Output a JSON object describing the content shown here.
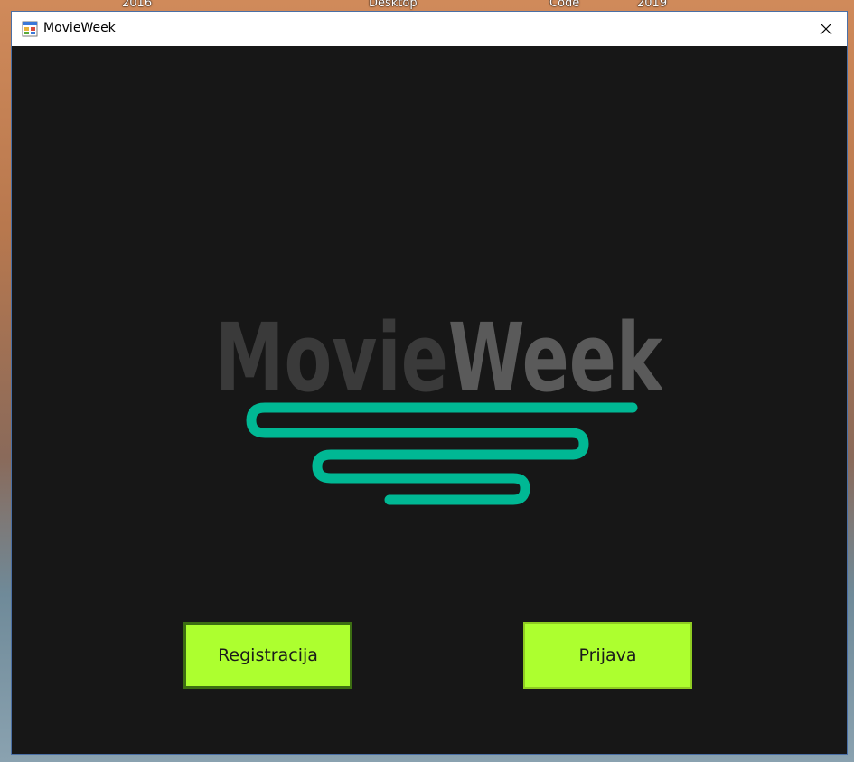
{
  "desktop": {
    "labels": [
      "2016",
      "Desktop",
      "Code",
      "2019"
    ]
  },
  "window": {
    "title": "MovieWeek",
    "icon": "app-forms-icon",
    "close_icon": "close-icon"
  },
  "logo": {
    "part1": "Movie",
    "part2": "Week",
    "colors": {
      "part1": "#3a3a3a",
      "part2": "#5a5a5a",
      "wave": "#00b894"
    }
  },
  "buttons": {
    "register": "Registracija",
    "login": "Prijava"
  },
  "colors": {
    "background": "#171717",
    "button": "#adff2f"
  }
}
